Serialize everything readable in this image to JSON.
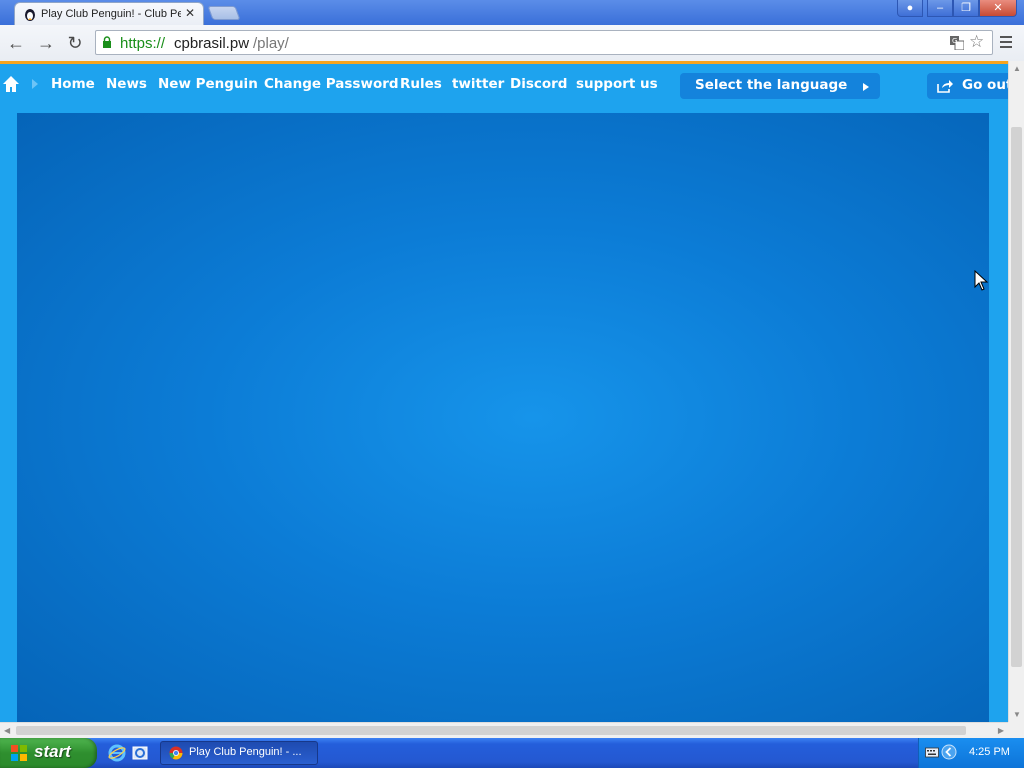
{
  "browser": {
    "tab_title": "Play Club Penguin! - Club Pe",
    "url_scheme": "https://",
    "url_host": "cpbrasil.pw",
    "url_path": "/play/"
  },
  "nav": {
    "links": [
      "Home",
      "News",
      "New Penguin",
      "Change Password",
      "Rules",
      "twitter",
      "Discord",
      "support us"
    ],
    "language_button": "Select the language",
    "go_out_button": "Go out"
  },
  "taskbar": {
    "start_label": "start",
    "task_label": "Play Club Penguin! - ...",
    "clock": "4:25 PM"
  },
  "colors": {
    "page_bg": "#1ea3ee",
    "accent_orange": "#f7a41e",
    "button_blue": "#1483dc",
    "game_center": "#1694ea",
    "game_edge": "#0564b8"
  },
  "icons": [
    "penguin-favicon",
    "lock-icon",
    "translate-icon",
    "star-icon",
    "menu-icon",
    "home-icon",
    "share-icon",
    "windows-logo"
  ]
}
